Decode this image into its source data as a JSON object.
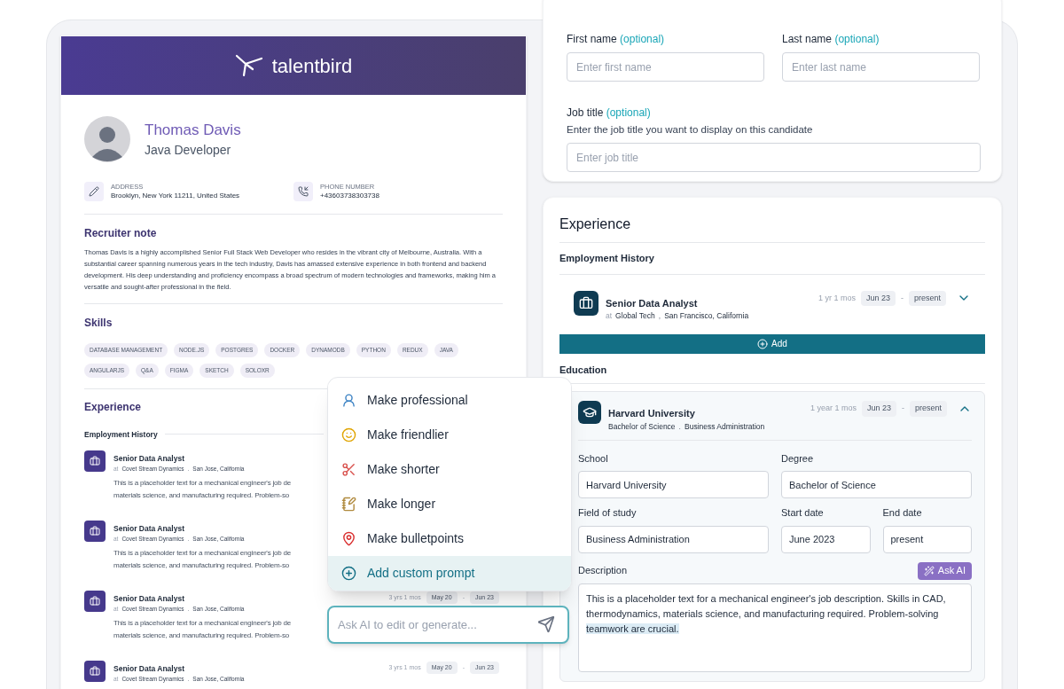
{
  "brand": {
    "name": "talentbird"
  },
  "profile": {
    "name": "Thomas Davis",
    "title": "Java Developer",
    "contacts": [
      {
        "label": "ADDRESS",
        "value": "Brooklyn, New York 11211, United States"
      },
      {
        "label": "PHONE NUMBER",
        "value": "+43603738303738"
      }
    ]
  },
  "recruiter_note": {
    "heading": "Recruiter note",
    "text": "Thomas Davis is a highly accomplished Senior Full Stack Web Developer who resides in the vibrant city of Melbourne, Australia. With a substantial career spanning numerous years in the tech industry, Davis has amassed extensive experience in both frontend and backend development. His deep understanding and proficiency encompass a broad spectrum of modern technologies and frameworks, making him a versatile and sought-after professional in the field."
  },
  "skills": {
    "heading": "Skills",
    "tags": [
      "DATABASE MANAGEMENT",
      "NODE.JS",
      "POSTGRES",
      "DOCKER",
      "DYNAMODB",
      "PYTHON",
      "REDUX",
      "JAVA",
      "ANGULARJS",
      "Q&A",
      "FIGMA",
      "SKETCH",
      "SOLOXR"
    ]
  },
  "resume_experience": {
    "heading": "Experience",
    "subheading": "Employment History",
    "entries": [
      {
        "title": "Senior Data Analyst",
        "prefix": "at",
        "company": "Covet Stream Dynamics",
        "separator": ".",
        "location": "San Jose, California",
        "description": [
          "This is a placeholder text for a mechanical engineer's job de",
          "materials science, and manufacturing required. Problem-so"
        ]
      },
      {
        "title": "Senior Data Analyst",
        "prefix": "at",
        "company": "Covet Stream Dynamics",
        "separator": ".",
        "location": "San Jose, California",
        "description": [
          "This is a placeholder text for a mechanical engineer's job de",
          "materials science, and manufacturing required. Problem-so"
        ]
      },
      {
        "title": "Senior Data Analyst",
        "prefix": "at",
        "company": "Covet Stream Dynamics",
        "separator": ".",
        "location": "San Jose, California",
        "description": [
          "This is a placeholder text for a mechanical engineer's job de",
          "materials science, and manufacturing required. Problem-so"
        ],
        "duration": "3 yrs 1 mos",
        "start": "May 20",
        "dash": "-",
        "end": "Jun 23"
      },
      {
        "title": "Senior Data Analyst",
        "prefix": "at",
        "company": "Covet Stream Dynamics",
        "separator": ".",
        "location": "San Jose, California",
        "duration": "3 yrs 1 mos",
        "start": "May 20",
        "dash": "-",
        "end": "Jun 23"
      }
    ]
  },
  "ai_menu": {
    "items": [
      {
        "label": "Make professional",
        "selected": false
      },
      {
        "label": "Make friendlier",
        "selected": false
      },
      {
        "label": "Make shorter",
        "selected": false
      },
      {
        "label": "Make longer",
        "selected": false
      },
      {
        "label": "Make bulletpoints",
        "selected": false
      },
      {
        "label": "Add custom prompt",
        "selected": true
      }
    ],
    "input": {
      "placeholder": "Ask AI to edit or generate..."
    }
  },
  "candidate_form": {
    "fields": [
      {
        "label": "First name",
        "optional": "(optional)",
        "placeholder": "Enter first name"
      },
      {
        "label": "Last name",
        "optional": "(optional)",
        "placeholder": "Enter last name"
      },
      {
        "label": "Job title",
        "optional": "(optional)",
        "help": "Enter the job title you want to display on this candidate",
        "placeholder": "Enter job title"
      }
    ]
  },
  "experience_editor": {
    "heading": "Experience",
    "employment_heading": "Employment History",
    "job": {
      "title": "Senior Data Analyst",
      "prefix": "at",
      "company": "Global Tech",
      "separator": ",",
      "location": "San Francisco, California",
      "duration": "1 yr 1 mos",
      "start": "Jun 23",
      "dash": "-",
      "end": "present",
      "expanded": false
    },
    "add_button": "Add",
    "education_heading": "Education",
    "education": {
      "school": "Harvard University",
      "degree": "Bachelor of Science",
      "separator": ".",
      "field": "Business Administration",
      "duration": "1 year 1 mos",
      "start": "Jun 23",
      "dash": "-",
      "end": "present",
      "expanded": true,
      "fields": [
        {
          "label": "School",
          "value": "Harvard University"
        },
        {
          "label": "Degree",
          "value": "Bachelor of Science"
        },
        {
          "label": "Field of study",
          "value": "Business Administration"
        },
        {
          "label": "Start date",
          "value": "June 2023"
        },
        {
          "label": "End date",
          "value": "present"
        }
      ],
      "description_label": "Description",
      "ask_ai": "Ask AI",
      "description": {
        "text": "This is a placeholder text for a mechanical engineer's job description. Skills in CAD, thermodynamics, materials science, and manufacturing required. Problem-solving ",
        "highlight": "teamwork are crucial."
      }
    }
  }
}
